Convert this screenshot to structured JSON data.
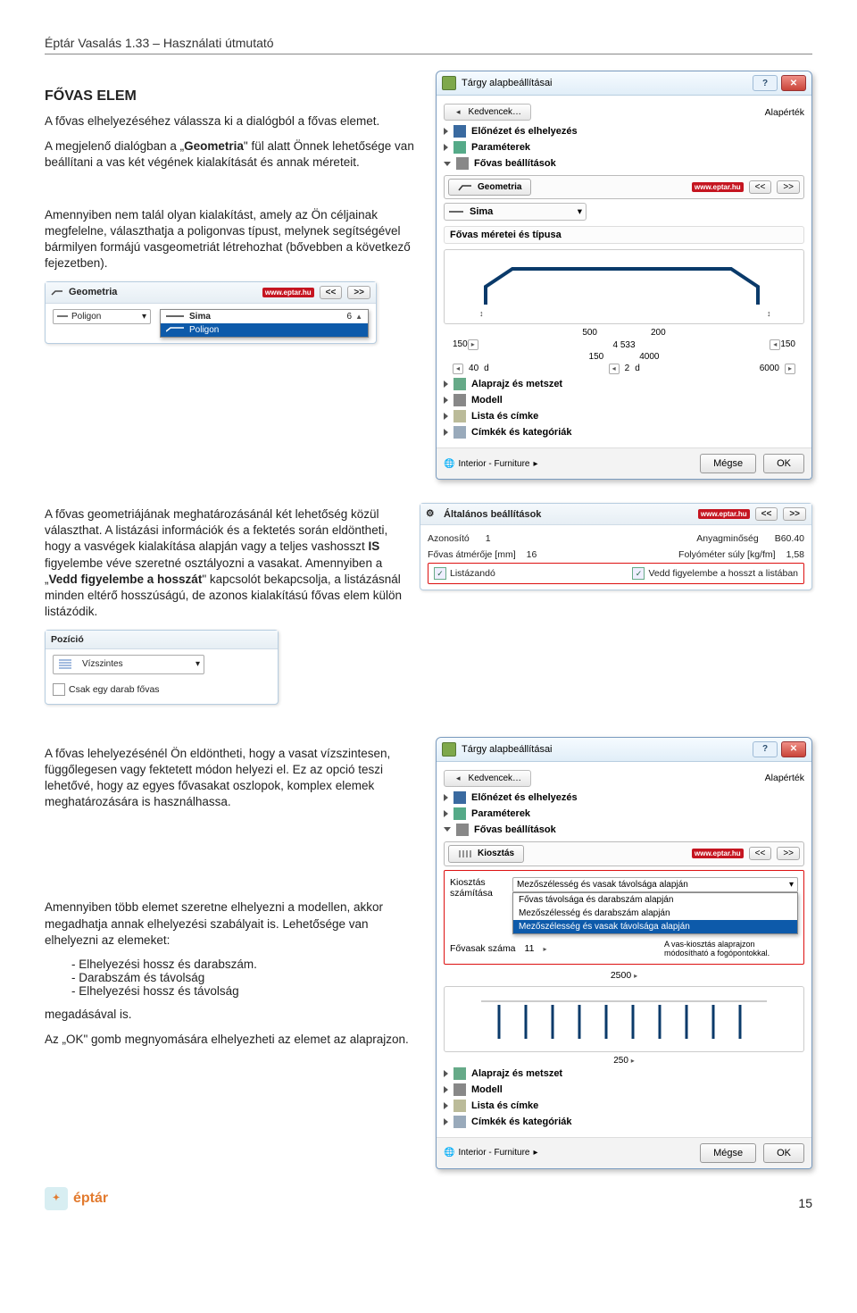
{
  "doc": {
    "header": "Éptár Vasalás 1.33 – Használati útmutató",
    "section_title": "FŐVAS ELEM",
    "p1": "A fővas elhelyezéséhez válassza ki a dialógból a fővas elemet.",
    "p2a": "A megjelenő dialógban a „",
    "p2b": "Geometria",
    "p2c": "\" fül alatt Önnek lehetősége van beállítani a vas két végének kialakítását és annak méreteit.",
    "p3": "Amennyiben nem talál olyan kialakítást, amely az Ön céljainak megfelelne, választhatja a poligonvas típust, melynek segítségével bármilyen formájú vasgeometriát létrehozhat (bővebben a következő fejezetben).",
    "p4": "A fővas geometriájának meghatározásánál két lehetőség közül választhat. A listázási információk és a fektetés során eldöntheti, hogy a vasvégek kialakítása alapján vagy a teljes vashosszt ",
    "p4_bold1": "IS",
    "p4_cont1": " figyelembe véve szeretné osztályozni a vasakat. Amennyiben a „",
    "p4_bold2": "Vedd figyelembe a hosszát",
    "p4_cont2": "\" kapcsolót bekapcsolja, a listázásnál minden eltérő hosszúságú, de azonos kialakítású fővas elem külön listázódik.",
    "p5": "A fővas lehelyezésénél Ön eldöntheti, hogy a vasat vízszintesen, függőlegesen vagy fektetett módon helyezi el. Ez az opció teszi lehetővé, hogy az egyes fővasakat oszlopok, komplex elemek meghatározására is használhassa.",
    "p6": "Amennyiben több elemet szeretne elhelyezni a modellen, akkor megadhatja annak elhelyezési szabályait is. Lehetősége van elhelyezni az elemeket:",
    "list1": "Elhelyezési hossz és darabszám.",
    "list2": "Darabszám és távolság",
    "list3": "Elhelyezési hossz és távolság",
    "p6_end": "megadásával is.",
    "p7": "Az „OK\" gomb megnyomására elhelyezheti az elemet az alaprajzon.",
    "page_num": "15",
    "logo_text": "éptár"
  },
  "dlg1": {
    "title": "Tárgy alapbeállításai",
    "fav": "Kedvencek…",
    "default": "Alapérték",
    "tree": [
      "Előnézet és elhelyezés",
      "Paraméterek",
      "Fővas beállítások"
    ],
    "tab": "Geometria",
    "badge": "www.eptar.hu",
    "nav_prev": "<<",
    "nav_next": ">>",
    "sub_tab": "Sima",
    "section2": "Fővas méretei és típusa",
    "dim1": "150",
    "dim2": "500",
    "dim3": "200",
    "dim4": "150",
    "dim5": "4 533",
    "dim6": "4000",
    "dim_d": "d",
    "dim_40": "40",
    "dim_2": "2",
    "dim_6000": "6000",
    "tree2": [
      "Alaprajz és metszet",
      "Modell",
      "Lista és címke",
      "Címkék és kategóriák"
    ],
    "footer_class": "Interior - Furniture",
    "btn_cancel": "Mégse",
    "btn_ok": "OK"
  },
  "inline_geo": {
    "hd": "Geometria",
    "badge": "www.eptar.hu",
    "nav_prev": "<<",
    "nav_next": ">>",
    "opt_sima": "Sima",
    "opt_poligon": "Poligon",
    "val": "6"
  },
  "inline_settings": {
    "hd": "Általános beállítások",
    "badge": "www.eptar.hu",
    "nav_prev": "<<",
    "nav_next": ">>",
    "row1a": "Azonosító",
    "row1a_val": "1",
    "row1b": "Anyagminőség",
    "row1b_val": "B60.40",
    "row2a": "Fővas átmérője [mm]",
    "row2a_val": "16",
    "row2b": "Folyóméter súly [kg/fm]",
    "row2b_val": "1,58",
    "cb1": "Listázandó",
    "cb2": "Vedd figyelembe a hosszt a listában"
  },
  "inline_pos": {
    "hd": "Pozíció",
    "val": "Vízszintes",
    "cb": "Csak egy darab fővas"
  },
  "dlg2": {
    "title": "Tárgy alapbeállításai",
    "fav": "Kedvencek…",
    "default": "Alapérték",
    "tree": [
      "Előnézet és elhelyezés",
      "Paraméterek",
      "Fővas beállítások"
    ],
    "tab": "Kiosztás",
    "badge": "www.eptar.hu",
    "nav_prev": "<<",
    "nav_next": ">>",
    "row_label": "Kiosztás számítása",
    "dd_sel": "Mezőszélesség és vasak távolsága alapján",
    "dd_opts": [
      "Fővas távolsága és darabszám alapján",
      "Mezőszélesség és darabszám alapján",
      "Mezőszélesség és vasak távolsága alapján"
    ],
    "row2": "Fővasak száma",
    "row2_val": "11",
    "row2_note": "A vas-kiosztás alaprajzon módosítható a fogópontokkal.",
    "dim": "2500",
    "dim2": "250",
    "tree2": [
      "Alaprajz és metszet",
      "Modell",
      "Lista és címke",
      "Címkék és kategóriák"
    ],
    "footer_class": "Interior - Furniture",
    "btn_cancel": "Mégse",
    "btn_ok": "OK"
  }
}
